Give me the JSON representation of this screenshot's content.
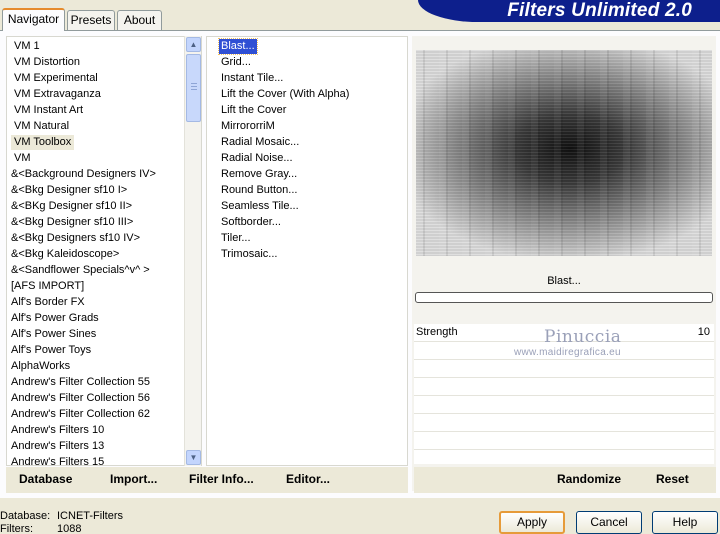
{
  "tabs": [
    "Navigator",
    "Presets",
    "About"
  ],
  "title": "Filters Unlimited 2.0",
  "categories": [
    "VM 1",
    "VM Distortion",
    "VM Experimental",
    "VM Extravaganza",
    "VM Instant Art",
    "VM Natural",
    "VM Toolbox",
    "VM",
    "&<Background Designers IV>",
    "&<Bkg Designer sf10 I>",
    "&<BKg Designer sf10 II>",
    "&<Bkg Designer sf10 III>",
    "&<Bkg Designers sf10 IV>",
    "&<Bkg Kaleidoscope>",
    "&<Sandflower Specials^v^ >",
    "[AFS IMPORT]",
    "Alf's Border FX",
    "Alf's Power Grads",
    "Alf's Power Sines",
    "Alf's Power Toys",
    "AlphaWorks",
    "Andrew's Filter Collection 55",
    "Andrew's Filter Collection 56",
    "Andrew's Filter Collection 62",
    "Andrew's Filters 10",
    "Andrew's Filters 13",
    "Andrew's Filters 15"
  ],
  "selected_category": "VM Toolbox",
  "filters": [
    "Blast...",
    "Grid...",
    "Instant Tile...",
    "Lift the Cover (With Alpha)",
    "Lift the Cover",
    "MirrororriM",
    "Radial Mosaic...",
    "Radial Noise...",
    "Remove Gray...",
    "Round Button...",
    "Seamless Tile...",
    "Softborder...",
    "Tiler...",
    "Trimosaic..."
  ],
  "selected_filter": "Blast...",
  "preview": {
    "filter_name": "Blast...",
    "params": [
      {
        "name": "Strength",
        "value": "10"
      }
    ],
    "watermark_name": "Pinuccia",
    "watermark_url": "www.maidiregrafica.eu"
  },
  "toolbar": {
    "database": "Database",
    "import": "Import...",
    "filter_info": "Filter Info...",
    "editor": "Editor...",
    "randomize": "Randomize",
    "reset": "Reset"
  },
  "status": {
    "database_label": "Database:",
    "database_value": "ICNET-Filters",
    "filters_label": "Filters:",
    "filters_value": "1088"
  },
  "buttons": {
    "apply": "Apply",
    "cancel": "Cancel",
    "help": "Help"
  }
}
